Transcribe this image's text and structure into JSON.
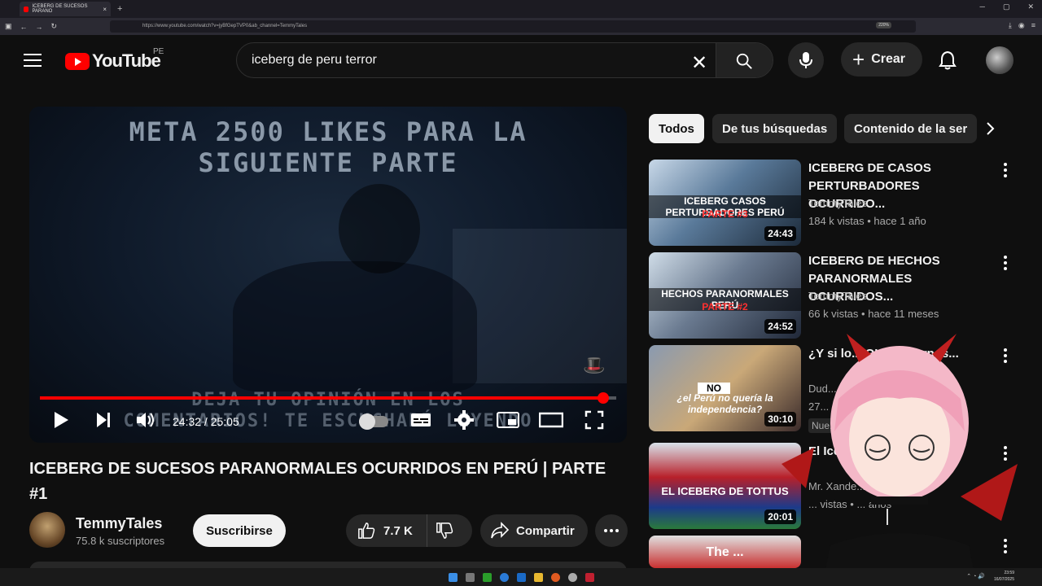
{
  "browser": {
    "tab_title": "ICEBERG DE SUCESOS PARANO",
    "tab_close": "×",
    "new_tab": "+",
    "url": "https://www.youtube.com/watch?v=jyBfGepTVP0&ab_channel=TemmyTales",
    "zoom": "220%"
  },
  "header": {
    "logo_text": "YouTube",
    "country_code": "PE",
    "search_value": "iceberg de peru terror",
    "create_label": "Crear"
  },
  "player": {
    "overlay_top": "META 2500 LIKES PARA LA\nSIGUIENTE PARTE",
    "overlay_bottom": "DEJA TU OPINIÓN EN LOS\nCOMENTARIOS! TE ESCUCHARÉ LEYENDO",
    "current_time": "24:32",
    "duration": "25:05",
    "time_display": "24:32 / 25:05",
    "progress_fraction": 0.978
  },
  "video": {
    "title": "ICEBERG DE SUCESOS PARANORMALES OCURRIDOS EN PERÚ | PARTE #1",
    "channel_name": "TemmyTales",
    "subscribers": "75.8 k suscriptores",
    "subscribe_label": "Suscribirse",
    "likes": "7.7 K",
    "share_label": "Compartir"
  },
  "chips": [
    {
      "label": "Todos",
      "active": true
    },
    {
      "label": "De tus búsquedas",
      "active": false
    },
    {
      "label": "Contenido de la ser",
      "active": false
    }
  ],
  "recommendations": [
    {
      "title": "ICEBERG DE CASOS PERTURBADORES OCURRIDO...",
      "channel": "TemmyTales",
      "meta": "184 k vistas • hace 1 año",
      "duration": "24:43",
      "thumb_text": "ICEBERG CASOS PERTURBADORES PERÚ",
      "thumb_sub": "PARTE #3"
    },
    {
      "title": "ICEBERG DE HECHOS PARANORMALES OCURRIDOS...",
      "channel": "TemmyTales",
      "meta": "66 k vistas • hace 11 meses",
      "duration": "24:52",
      "thumb_text": "HECHOS PARANORMALES PERÚ",
      "thumb_sub": "PARTE #2"
    },
    {
      "title": "¿Y si lo... QUE... ...arnos...",
      "channel": "Dud...",
      "meta": "27...",
      "badge": "Nue... ...ático",
      "duration": "30:10",
      "thumb_text": "¿el Perú no quería la independencia?",
      "thumb_sub": "NO"
    },
    {
      "title": "El Ice...",
      "channel": "Mr. Xande...",
      "meta": "... vistas • ... años",
      "duration": "20:01",
      "thumb_text": "EL ICEBERG DE TOTTUS",
      "thumb_sub": ""
    },
    {
      "title": "",
      "channel": "",
      "meta": "",
      "duration": "",
      "thumb_text": "The ...",
      "thumb_sub": ""
    }
  ],
  "taskbar": {
    "time": "23:59",
    "date": "16/07/2025"
  },
  "colors": {
    "background": "#0f0f0f",
    "accent_red": "#ff0000",
    "chip_bg": "#272727",
    "text_secondary": "#aaaaaa"
  }
}
